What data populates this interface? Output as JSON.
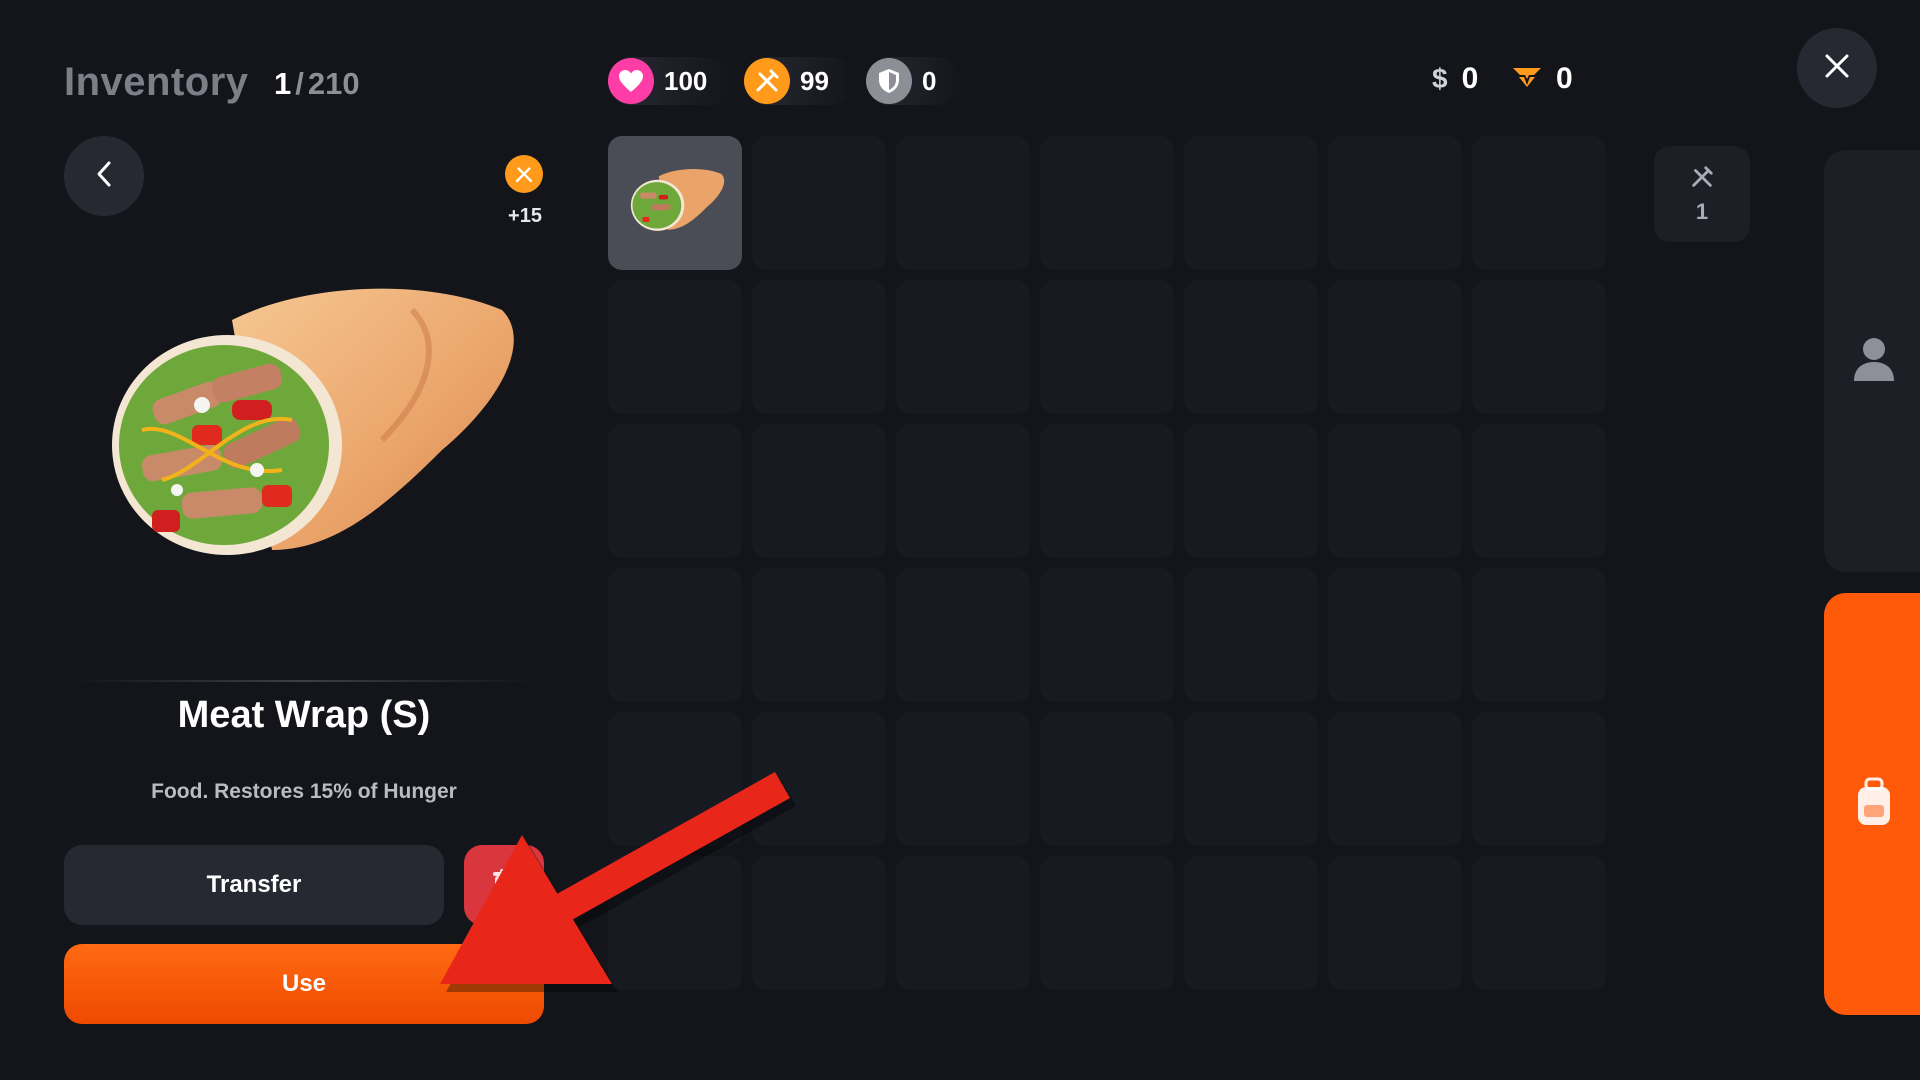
{
  "header": {
    "title": "Inventory",
    "count_current": "1",
    "count_separator": "/",
    "count_max": "210"
  },
  "stats": {
    "health": {
      "icon": "heart-icon",
      "value": "100",
      "color": "#ff3da6"
    },
    "hunger": {
      "icon": "fork-knife-icon",
      "value": "99",
      "color": "#ff9a1a"
    },
    "armor": {
      "icon": "shield-icon",
      "value": "0",
      "color": "#8d8f96"
    }
  },
  "currency": {
    "cash_symbol": "$",
    "cash_value": "0",
    "coins_icon": "premium-coin-icon",
    "coins_value": "0"
  },
  "selected_item": {
    "name": "Meat Wrap (S)",
    "description": "Food. Restores 15% of Hunger",
    "bonus_icon": "fork-knife-icon",
    "bonus_value": "+15",
    "image": "meat-wrap-image"
  },
  "actions": {
    "transfer_label": "Transfer",
    "use_label": "Use",
    "delete_icon": "trash-icon"
  },
  "grid": {
    "columns": 7,
    "rows": 6,
    "filled_slots": [
      {
        "index": 0,
        "item": "meat-wrap"
      }
    ]
  },
  "filter": {
    "icon": "fork-knife-icon",
    "count": "1"
  },
  "side_tabs": [
    {
      "name": "profile",
      "icon": "person-icon",
      "active": false
    },
    {
      "name": "backpack",
      "icon": "backpack-icon",
      "active": true
    }
  ],
  "colors": {
    "accent": "#ff5a0a",
    "background": "#13151b",
    "danger": "#d9363e",
    "annotation_arrow": "#e8261a"
  }
}
